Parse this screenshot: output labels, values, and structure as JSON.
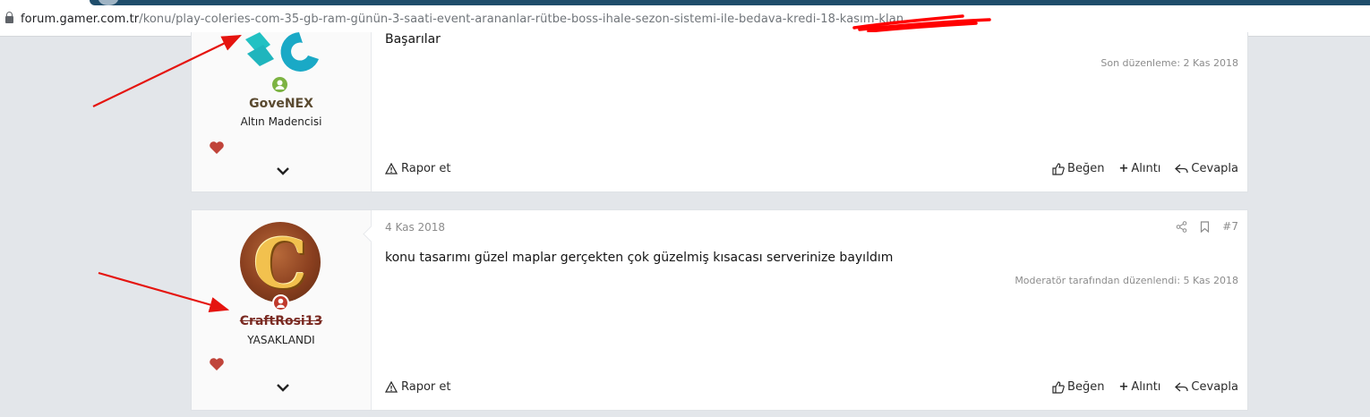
{
  "browser": {
    "url_host": "forum.gamer.com.tr",
    "url_path": "/konu/play-coleries-com-35-gb-ram-günün-3-saati-event-arananlar-rütbe-boss-ihale-sezon-sistemi-ile-bedava-kredi-18-kasım-klan..."
  },
  "posts": [
    {
      "username": "GoveNEX",
      "user_title": "Altın Madencisi",
      "message": "Başarılar",
      "edited": "Son düzenleme: 2 Kas 2018",
      "report_label": "Rapor et",
      "actions": {
        "like": "Beğen",
        "quote": "Alıntı",
        "reply": "Cevapla"
      }
    },
    {
      "date": "4 Kas 2018",
      "post_number": "#7",
      "username": "CraftRosi13",
      "user_title": "YASAKLANDI",
      "avatar_letter": "C",
      "message": "konu tasarımı güzel maplar gerçekten çok güzelmiş kısacası serverinize bayıldım",
      "edited": "Moderatör tarafından düzenlendi: 5 Kas 2018",
      "report_label": "Rapor et",
      "actions": {
        "like": "Beğen",
        "quote": "Alıntı",
        "reply": "Cevapla"
      }
    }
  ],
  "colors": {
    "online_status": "#7cb342",
    "banned_status": "#c0392b",
    "heart": "#c0443a",
    "arrow": "#e5140f"
  }
}
